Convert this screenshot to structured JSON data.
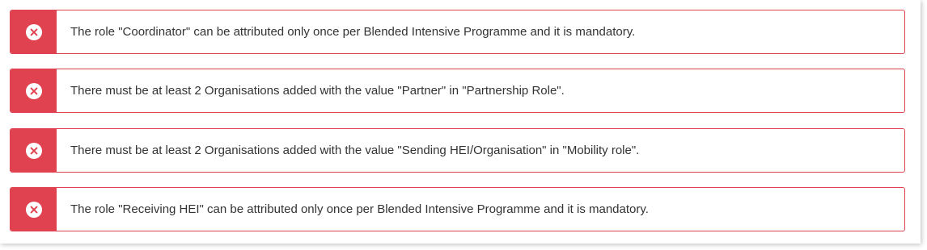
{
  "colors": {
    "error_accent": "#e0434f",
    "text": "#333333",
    "background": "#ffffff"
  },
  "alerts": [
    {
      "icon": "error-circle-x-icon",
      "message": "The role \"Coordinator\" can be attributed only once per Blended Intensive Programme and it is mandatory."
    },
    {
      "icon": "error-circle-x-icon",
      "message": "There must be at least 2 Organisations added with the value \"Partner\" in \"Partnership Role\"."
    },
    {
      "icon": "error-circle-x-icon",
      "message": "There must be at least 2 Organisations added with the value \"Sending HEI/Organisation\" in \"Mobility role\"."
    },
    {
      "icon": "error-circle-x-icon",
      "message": "The role \"Receiving HEI\" can be attributed only once per Blended Intensive Programme and it is mandatory."
    }
  ]
}
